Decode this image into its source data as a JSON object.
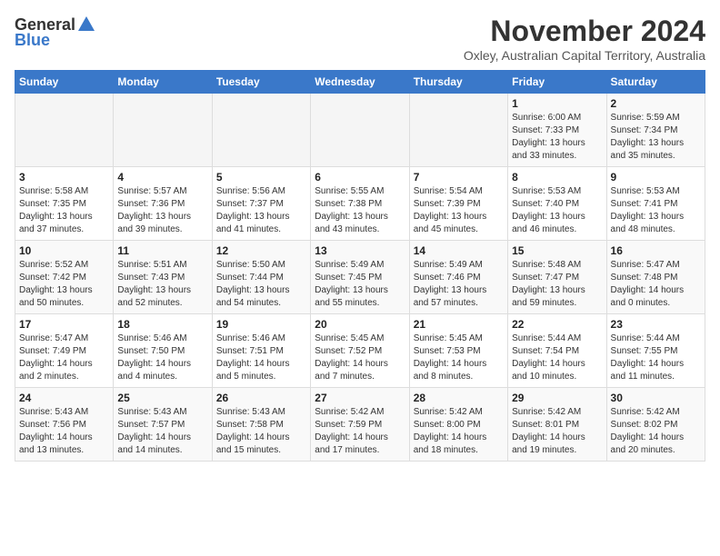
{
  "logo": {
    "general": "General",
    "blue": "Blue"
  },
  "title": "November 2024",
  "subtitle": "Oxley, Australian Capital Territory, Australia",
  "days_of_week": [
    "Sunday",
    "Monday",
    "Tuesday",
    "Wednesday",
    "Thursday",
    "Friday",
    "Saturday"
  ],
  "weeks": [
    [
      {
        "day": "",
        "info": ""
      },
      {
        "day": "",
        "info": ""
      },
      {
        "day": "",
        "info": ""
      },
      {
        "day": "",
        "info": ""
      },
      {
        "day": "",
        "info": ""
      },
      {
        "day": "1",
        "info": "Sunrise: 6:00 AM\nSunset: 7:33 PM\nDaylight: 13 hours\nand 33 minutes."
      },
      {
        "day": "2",
        "info": "Sunrise: 5:59 AM\nSunset: 7:34 PM\nDaylight: 13 hours\nand 35 minutes."
      }
    ],
    [
      {
        "day": "3",
        "info": "Sunrise: 5:58 AM\nSunset: 7:35 PM\nDaylight: 13 hours\nand 37 minutes."
      },
      {
        "day": "4",
        "info": "Sunrise: 5:57 AM\nSunset: 7:36 PM\nDaylight: 13 hours\nand 39 minutes."
      },
      {
        "day": "5",
        "info": "Sunrise: 5:56 AM\nSunset: 7:37 PM\nDaylight: 13 hours\nand 41 minutes."
      },
      {
        "day": "6",
        "info": "Sunrise: 5:55 AM\nSunset: 7:38 PM\nDaylight: 13 hours\nand 43 minutes."
      },
      {
        "day": "7",
        "info": "Sunrise: 5:54 AM\nSunset: 7:39 PM\nDaylight: 13 hours\nand 45 minutes."
      },
      {
        "day": "8",
        "info": "Sunrise: 5:53 AM\nSunset: 7:40 PM\nDaylight: 13 hours\nand 46 minutes."
      },
      {
        "day": "9",
        "info": "Sunrise: 5:53 AM\nSunset: 7:41 PM\nDaylight: 13 hours\nand 48 minutes."
      }
    ],
    [
      {
        "day": "10",
        "info": "Sunrise: 5:52 AM\nSunset: 7:42 PM\nDaylight: 13 hours\nand 50 minutes."
      },
      {
        "day": "11",
        "info": "Sunrise: 5:51 AM\nSunset: 7:43 PM\nDaylight: 13 hours\nand 52 minutes."
      },
      {
        "day": "12",
        "info": "Sunrise: 5:50 AM\nSunset: 7:44 PM\nDaylight: 13 hours\nand 54 minutes."
      },
      {
        "day": "13",
        "info": "Sunrise: 5:49 AM\nSunset: 7:45 PM\nDaylight: 13 hours\nand 55 minutes."
      },
      {
        "day": "14",
        "info": "Sunrise: 5:49 AM\nSunset: 7:46 PM\nDaylight: 13 hours\nand 57 minutes."
      },
      {
        "day": "15",
        "info": "Sunrise: 5:48 AM\nSunset: 7:47 PM\nDaylight: 13 hours\nand 59 minutes."
      },
      {
        "day": "16",
        "info": "Sunrise: 5:47 AM\nSunset: 7:48 PM\nDaylight: 14 hours\nand 0 minutes."
      }
    ],
    [
      {
        "day": "17",
        "info": "Sunrise: 5:47 AM\nSunset: 7:49 PM\nDaylight: 14 hours\nand 2 minutes."
      },
      {
        "day": "18",
        "info": "Sunrise: 5:46 AM\nSunset: 7:50 PM\nDaylight: 14 hours\nand 4 minutes."
      },
      {
        "day": "19",
        "info": "Sunrise: 5:46 AM\nSunset: 7:51 PM\nDaylight: 14 hours\nand 5 minutes."
      },
      {
        "day": "20",
        "info": "Sunrise: 5:45 AM\nSunset: 7:52 PM\nDaylight: 14 hours\nand 7 minutes."
      },
      {
        "day": "21",
        "info": "Sunrise: 5:45 AM\nSunset: 7:53 PM\nDaylight: 14 hours\nand 8 minutes."
      },
      {
        "day": "22",
        "info": "Sunrise: 5:44 AM\nSunset: 7:54 PM\nDaylight: 14 hours\nand 10 minutes."
      },
      {
        "day": "23",
        "info": "Sunrise: 5:44 AM\nSunset: 7:55 PM\nDaylight: 14 hours\nand 11 minutes."
      }
    ],
    [
      {
        "day": "24",
        "info": "Sunrise: 5:43 AM\nSunset: 7:56 PM\nDaylight: 14 hours\nand 13 minutes."
      },
      {
        "day": "25",
        "info": "Sunrise: 5:43 AM\nSunset: 7:57 PM\nDaylight: 14 hours\nand 14 minutes."
      },
      {
        "day": "26",
        "info": "Sunrise: 5:43 AM\nSunset: 7:58 PM\nDaylight: 14 hours\nand 15 minutes."
      },
      {
        "day": "27",
        "info": "Sunrise: 5:42 AM\nSunset: 7:59 PM\nDaylight: 14 hours\nand 17 minutes."
      },
      {
        "day": "28",
        "info": "Sunrise: 5:42 AM\nSunset: 8:00 PM\nDaylight: 14 hours\nand 18 minutes."
      },
      {
        "day": "29",
        "info": "Sunrise: 5:42 AM\nSunset: 8:01 PM\nDaylight: 14 hours\nand 19 minutes."
      },
      {
        "day": "30",
        "info": "Sunrise: 5:42 AM\nSunset: 8:02 PM\nDaylight: 14 hours\nand 20 minutes."
      }
    ]
  ]
}
